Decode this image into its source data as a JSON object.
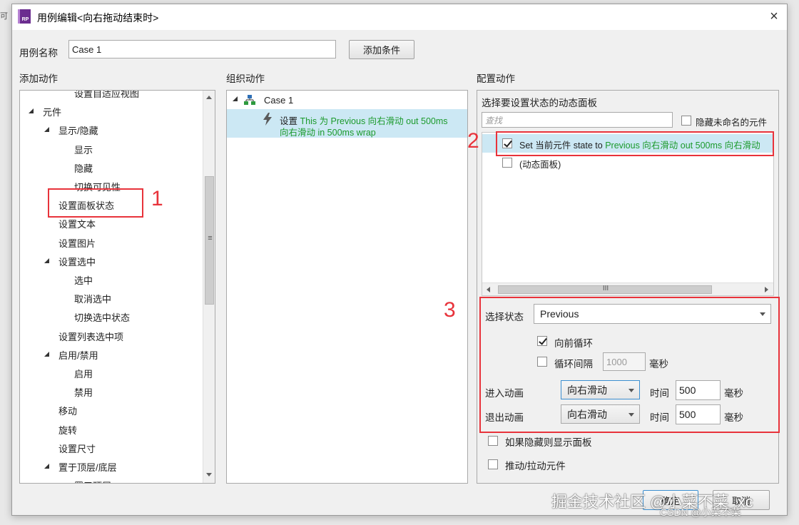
{
  "window": {
    "title": "用例编辑<向右拖动结束时>",
    "close_icon": "×",
    "app_icon_text": "RP"
  },
  "case_name": {
    "label": "用例名称",
    "value": "Case 1"
  },
  "add_condition_button": "添加条件",
  "left_panel": {
    "header": "添加动作",
    "items": [
      {
        "label": "设置自适应视图",
        "level": 2,
        "expander": false
      },
      {
        "label": "元件",
        "level": 0,
        "expander": true
      },
      {
        "label": "显示/隐藏",
        "level": 1,
        "expander": true
      },
      {
        "label": "显示",
        "level": 2,
        "expander": false
      },
      {
        "label": "隐藏",
        "level": 2,
        "expander": false
      },
      {
        "label": "切换可见性",
        "level": 2,
        "expander": false
      },
      {
        "label": "设置面板状态",
        "level": 1,
        "expander": false
      },
      {
        "label": "设置文本",
        "level": 1,
        "expander": false
      },
      {
        "label": "设置图片",
        "level": 1,
        "expander": false
      },
      {
        "label": "设置选中",
        "level": 1,
        "expander": true
      },
      {
        "label": "选中",
        "level": 2,
        "expander": false
      },
      {
        "label": "取消选中",
        "level": 2,
        "expander": false
      },
      {
        "label": "切换选中状态",
        "level": 2,
        "expander": false
      },
      {
        "label": "设置列表选中项",
        "level": 1,
        "expander": false
      },
      {
        "label": "启用/禁用",
        "level": 1,
        "expander": true
      },
      {
        "label": "启用",
        "level": 2,
        "expander": false
      },
      {
        "label": "禁用",
        "level": 2,
        "expander": false
      },
      {
        "label": "移动",
        "level": 1,
        "expander": false
      },
      {
        "label": "旋转",
        "level": 1,
        "expander": false
      },
      {
        "label": "设置尺寸",
        "level": 1,
        "expander": false
      },
      {
        "label": "置于顶层/底层",
        "level": 1,
        "expander": true
      },
      {
        "label": "置于顶层",
        "level": 2,
        "expander": false
      }
    ],
    "scroll_grip": "≡"
  },
  "middle_panel": {
    "header": "组织动作",
    "case_label": "Case 1",
    "action_prefix": "设置",
    "action_line1": "This 为 Previous 向右滑动 out 500ms",
    "action_line2": "向右滑动 in 500ms wrap"
  },
  "right_panel": {
    "header": "配置动作",
    "sub_header": "选择要设置状态的动态面板",
    "search_placeholder": "查找",
    "hide_unnamed_label": "隐藏未命名的元件",
    "hide_unnamed_checked": false,
    "row1_prefix": "Set 当前元件 state to ",
    "row1_green": "Previous 向右滑动 out 500ms 向右滑动",
    "row1_checked": true,
    "row2_label": "(动态面板)",
    "row2_checked": false,
    "hscroll_grip": "III",
    "select_state_label": "选择状态",
    "select_state_value": "Previous",
    "loop_forward_label": "向前循环",
    "loop_forward_checked": true,
    "loop_interval_label": "循环间隔",
    "loop_interval_value": "1000",
    "loop_interval_checked": false,
    "ms_unit": "毫秒",
    "enter_anim_label": "进入动画",
    "enter_anim_value": "向右滑动",
    "exit_anim_label": "退出动画",
    "exit_anim_value": "向右滑动",
    "time_label": "时间",
    "enter_time_value": "500",
    "exit_time_value": "500",
    "show_if_hidden_label": "如果隐藏则显示面板",
    "show_if_hidden_checked": false,
    "push_pull_label": "推动/拉动元件",
    "push_pull_checked": false
  },
  "footer": {
    "ok_button": "确定",
    "cancel_button": "取消"
  },
  "annotations": {
    "n1": "1",
    "n2": "2",
    "n3": "3",
    "color": "#e8333b"
  },
  "watermarks": {
    "main": "掘金技术社区 @小菜不菜_xc",
    "csdn": "CSDN @小菜不菜"
  },
  "background_fragment": "可 /"
}
